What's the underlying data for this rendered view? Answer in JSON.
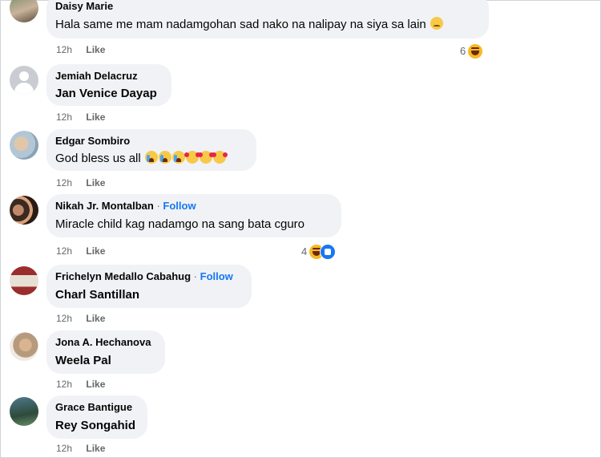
{
  "comments": [
    {
      "author": "Daisy Marie",
      "text": "Hala same me mam nadamgohan sad nako na nalipay na siya sa lain",
      "time": "12h",
      "like_label": "Like",
      "reaction_count": "6",
      "follow": ""
    },
    {
      "author": "Jemiah Delacruz",
      "text": "Jan Venice Dayap",
      "time": "12h",
      "like_label": "Like",
      "follow": ""
    },
    {
      "author": "Edgar Sombiro",
      "text": "God bless us all",
      "time": "12h",
      "like_label": "Like",
      "follow": ""
    },
    {
      "author": "Nikah Jr. Montalban",
      "separator": "·",
      "follow": "Follow",
      "text": "Miracle child kag nadamgo na sang bata cguro",
      "time": "12h",
      "like_label": "Like",
      "reaction_count": "4"
    },
    {
      "author": "Frichelyn Medallo Cabahug",
      "separator": "·",
      "follow": "Follow",
      "text": "Charl Santillan",
      "time": "12h",
      "like_label": "Like"
    },
    {
      "author": "Jona A. Hechanova",
      "text": "Weela Pal",
      "time": "12h",
      "like_label": "Like",
      "follow": ""
    },
    {
      "author": "Grace Bantigue",
      "text": "Rey Songahid",
      "time": "12h",
      "like_label": "Like",
      "follow": ""
    }
  ],
  "colors": {
    "bubble": "#f0f2f5",
    "link": "#1877f2",
    "meta": "#65676b",
    "text": "#050505"
  }
}
